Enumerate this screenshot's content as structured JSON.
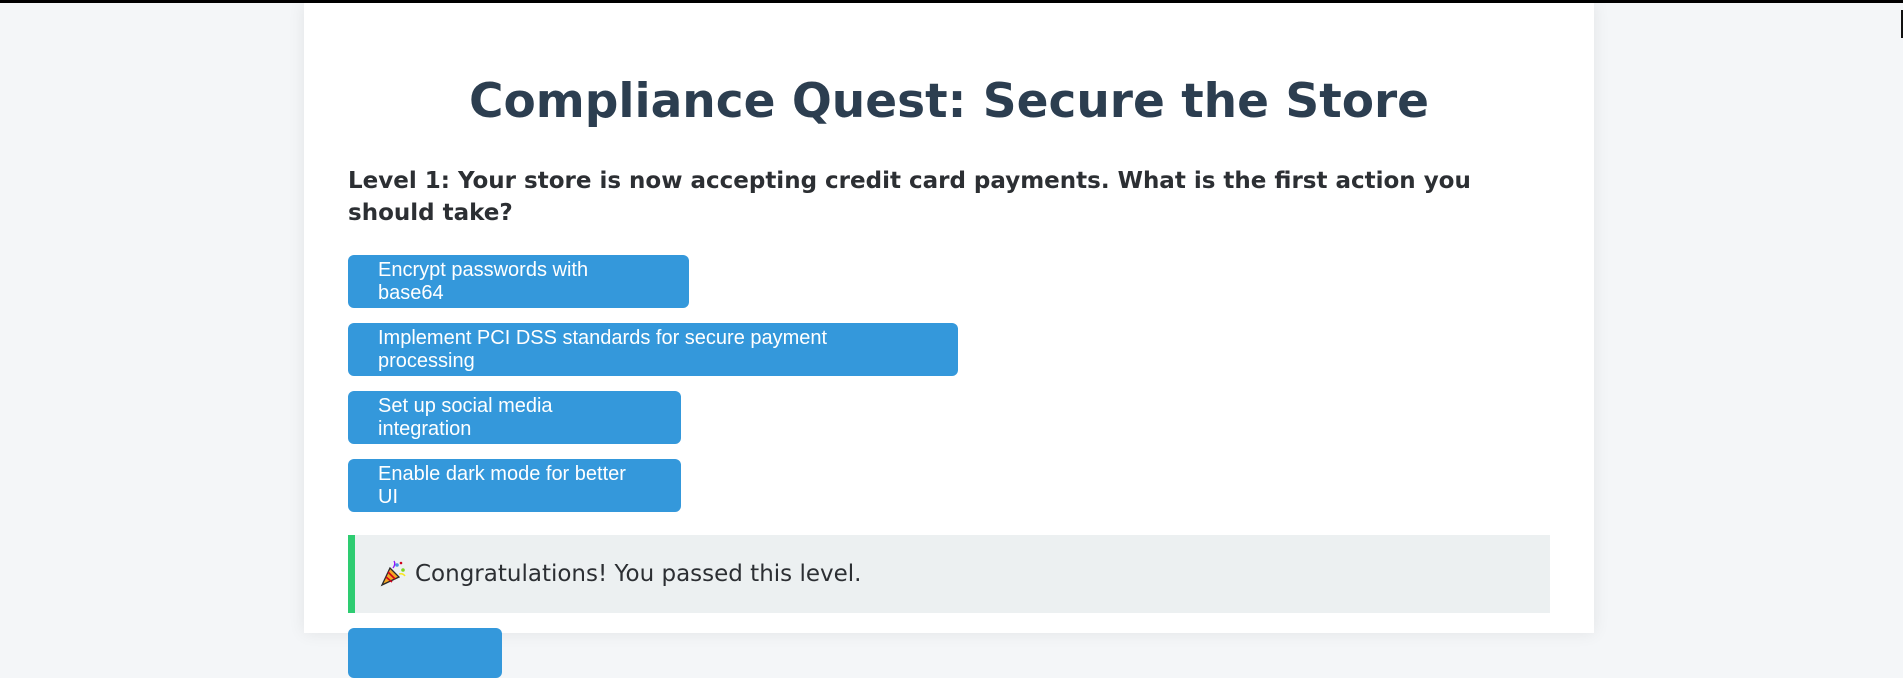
{
  "quiz": {
    "title": "Compliance Quest: Secure the Store",
    "question": "Level 1: Your store is now accepting credit card payments. What is the first action you should take?",
    "options": [
      "Encrypt passwords with base64",
      "Implement PCI DSS standards for secure payment processing",
      "Set up social media integration",
      "Enable dark mode for better UI"
    ],
    "feedback": {
      "icon": "party-popper-icon",
      "text": "Congratulations! You passed this level."
    }
  },
  "colors": {
    "accent": "#3498db",
    "success": "#2ecc71",
    "title": "#2c3e50"
  }
}
